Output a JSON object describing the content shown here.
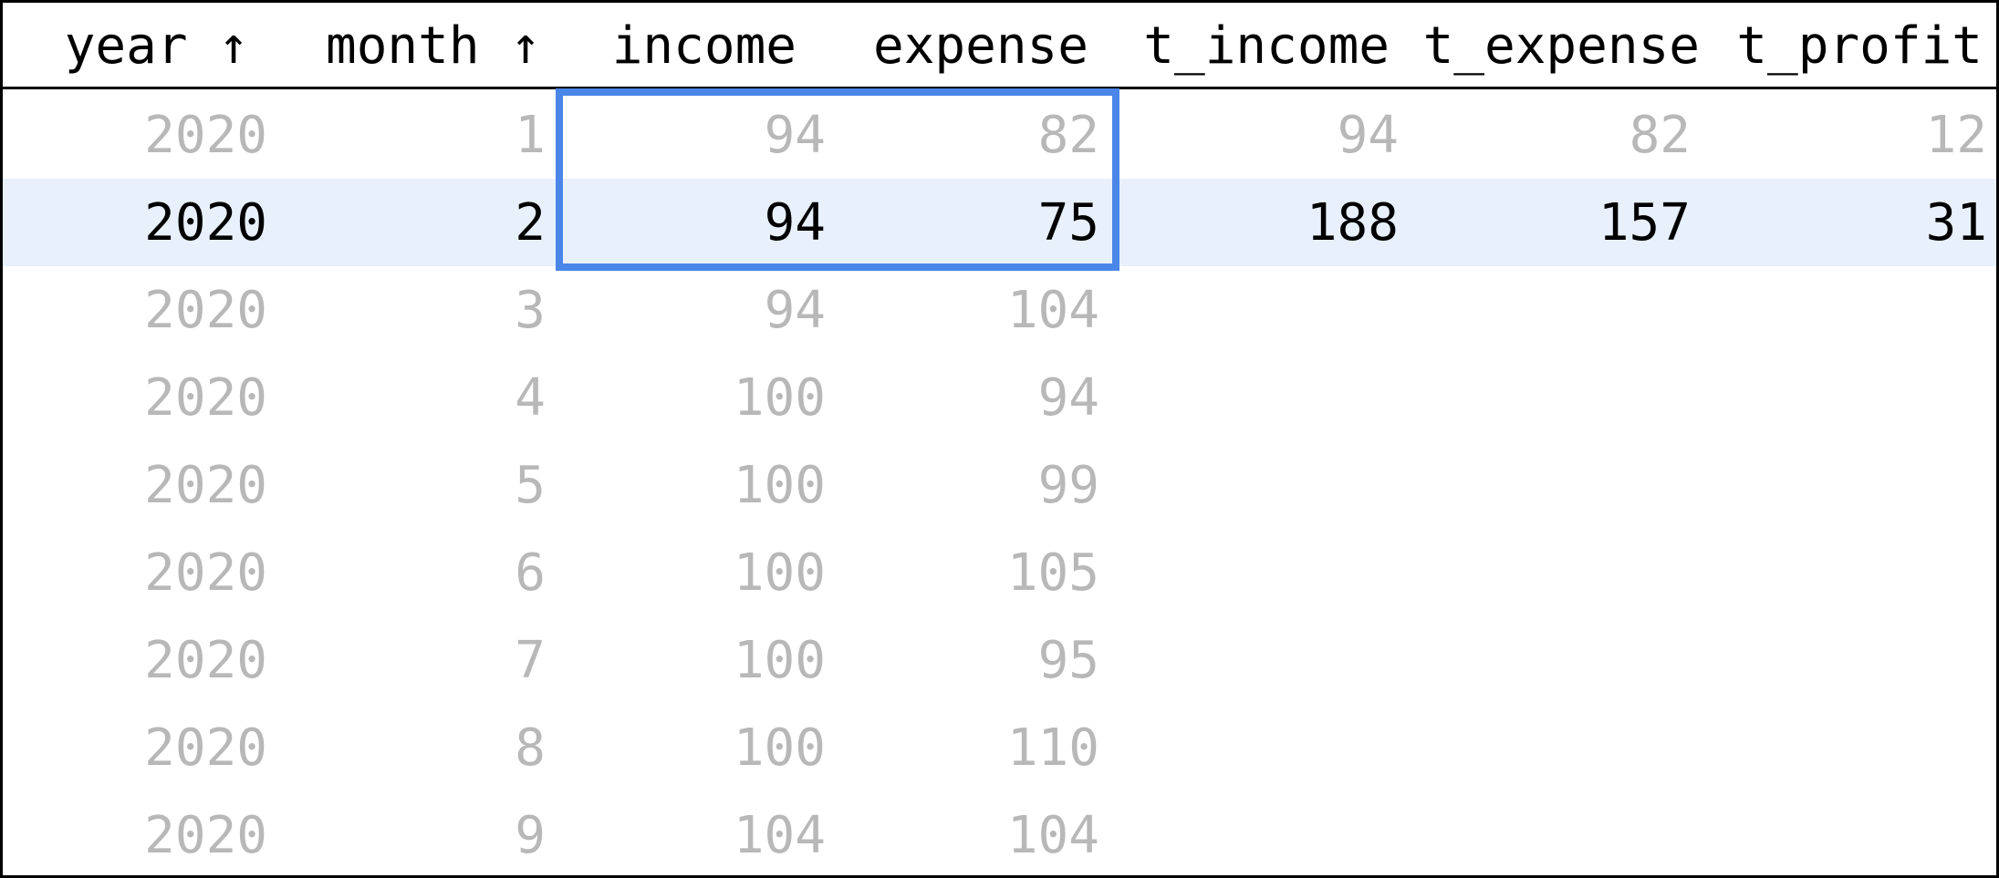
{
  "columns": [
    {
      "key": "year",
      "label": "year ↑"
    },
    {
      "key": "month",
      "label": "month ↑"
    },
    {
      "key": "income",
      "label": "income"
    },
    {
      "key": "expense",
      "label": "expense"
    },
    {
      "key": "t_income",
      "label": "t_income"
    },
    {
      "key": "t_expense",
      "label": "t_expense"
    },
    {
      "key": "t_profit",
      "label": "t_profit"
    }
  ],
  "rows": [
    {
      "year": "2020",
      "month": "1",
      "income": "94",
      "expense": "82",
      "t_income": "94",
      "t_expense": "82",
      "t_profit": "12"
    },
    {
      "year": "2020",
      "month": "2",
      "income": "94",
      "expense": "75",
      "t_income": "188",
      "t_expense": "157",
      "t_profit": "31"
    },
    {
      "year": "2020",
      "month": "3",
      "income": "94",
      "expense": "104",
      "t_income": "",
      "t_expense": "",
      "t_profit": ""
    },
    {
      "year": "2020",
      "month": "4",
      "income": "100",
      "expense": "94",
      "t_income": "",
      "t_expense": "",
      "t_profit": ""
    },
    {
      "year": "2020",
      "month": "5",
      "income": "100",
      "expense": "99",
      "t_income": "",
      "t_expense": "",
      "t_profit": ""
    },
    {
      "year": "2020",
      "month": "6",
      "income": "100",
      "expense": "105",
      "t_income": "",
      "t_expense": "",
      "t_profit": ""
    },
    {
      "year": "2020",
      "month": "7",
      "income": "100",
      "expense": "95",
      "t_income": "",
      "t_expense": "",
      "t_profit": ""
    },
    {
      "year": "2020",
      "month": "8",
      "income": "100",
      "expense": "110",
      "t_income": "",
      "t_expense": "",
      "t_profit": ""
    },
    {
      "year": "2020",
      "month": "9",
      "income": "104",
      "expense": "104",
      "t_income": "",
      "t_expense": "",
      "t_profit": ""
    }
  ],
  "active_row_index": 1,
  "colors": {
    "accent": "#4a86e8",
    "active_row": "#e8f0fc",
    "dim_text": "#b8b8b8"
  }
}
